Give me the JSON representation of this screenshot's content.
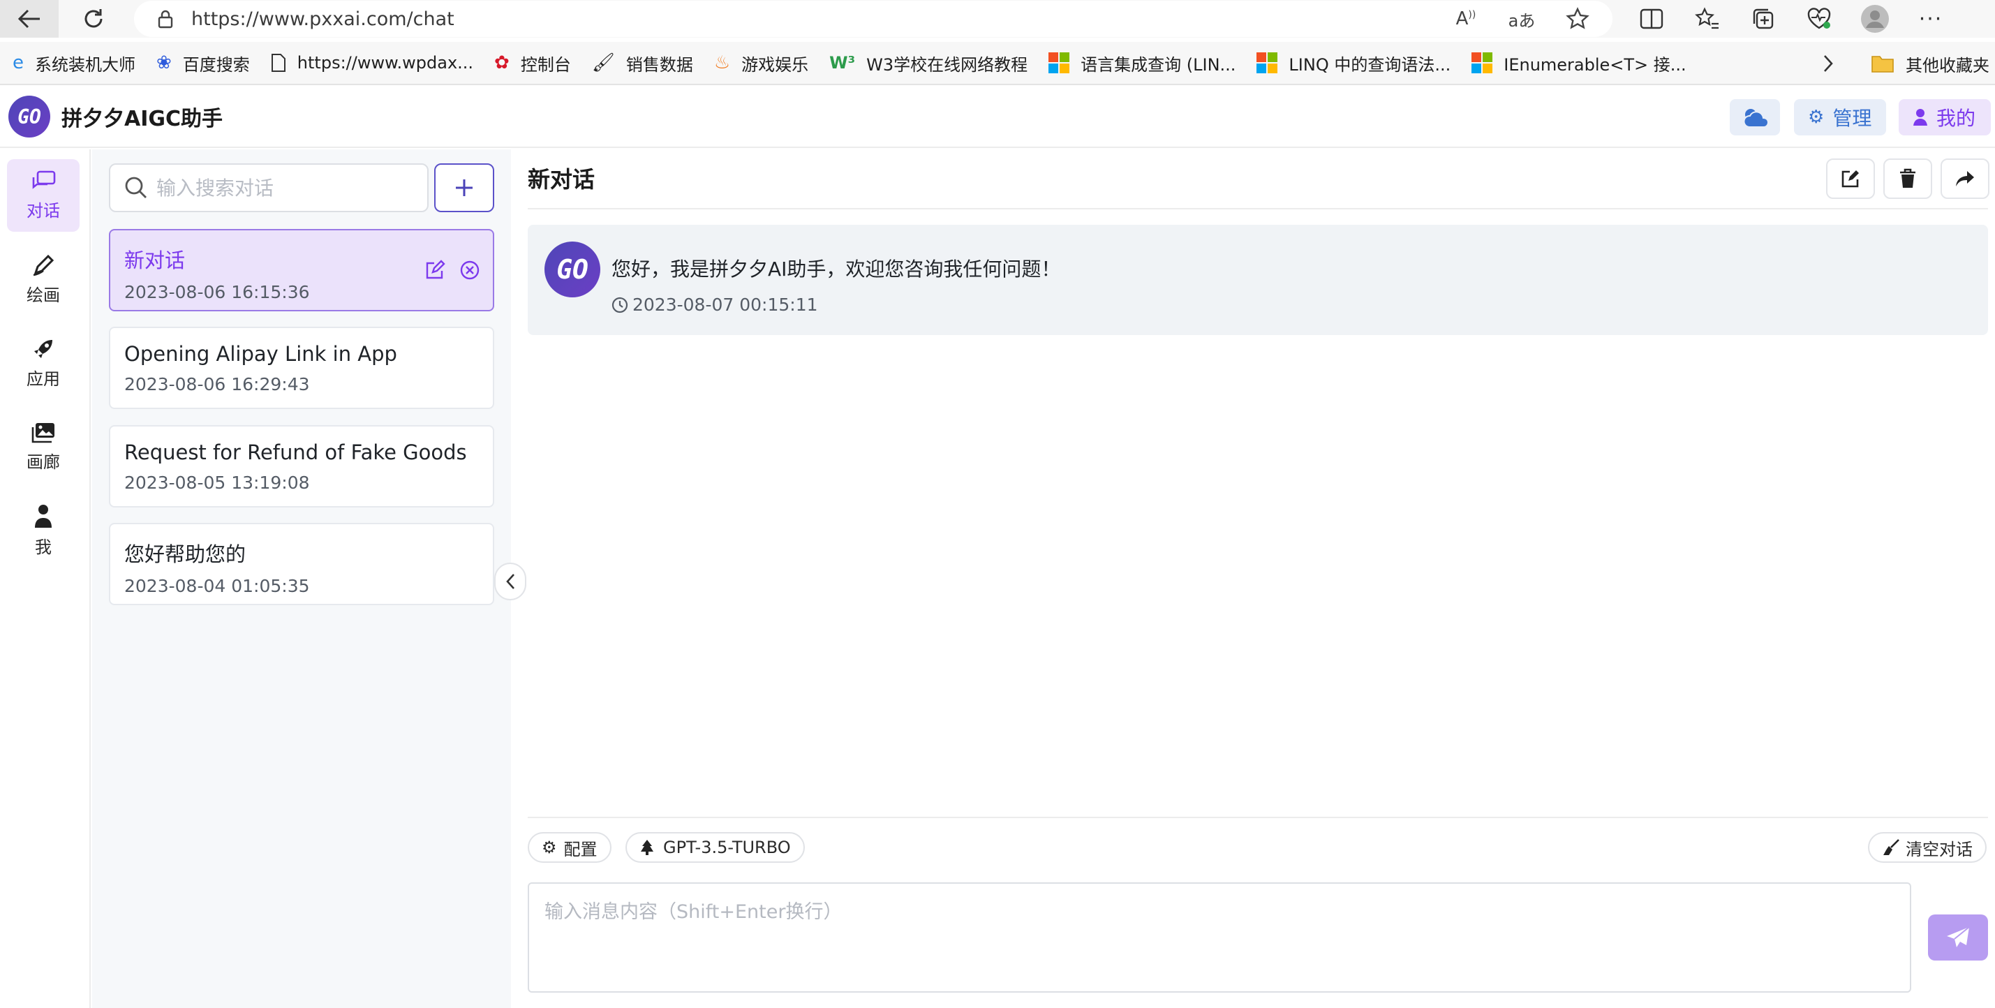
{
  "browser": {
    "url": "https://www.pxxai.com/chat",
    "bookmarks": [
      {
        "label": "系统装机大师",
        "icon": "edge-icon"
      },
      {
        "label": "百度搜索",
        "icon": "baidu-paw-icon"
      },
      {
        "label": "https://www.wpdax...",
        "icon": "page-icon"
      },
      {
        "label": "控制台",
        "icon": "huawei-icon"
      },
      {
        "label": "销售数据",
        "icon": "brush-icon"
      },
      {
        "label": "游戏娱乐",
        "icon": "flame-icon"
      },
      {
        "label": "W3学校在线网络教程",
        "icon": "w3-icon"
      },
      {
        "label": "语言集成查询 (LIN...",
        "icon": "microsoft-icon"
      },
      {
        "label": "LINQ 中的查询语法...",
        "icon": "microsoft-icon"
      },
      {
        "label": "IEnumerable<T> 接...",
        "icon": "microsoft-icon"
      }
    ],
    "other_bookmarks": "其他收藏夹"
  },
  "app": {
    "logo_text": "GO",
    "title": "拼夕夕AIGC助手",
    "admin_label": "管理",
    "mine_label": "我的"
  },
  "rail": [
    {
      "label": "对话",
      "icon": "chat-icon"
    },
    {
      "label": "绘画",
      "icon": "pen-icon"
    },
    {
      "label": "应用",
      "icon": "rocket-icon"
    },
    {
      "label": "画廊",
      "icon": "gallery-icon"
    },
    {
      "label": "我",
      "icon": "user-icon"
    }
  ],
  "search": {
    "placeholder": "输入搜索对话"
  },
  "conversations": [
    {
      "title": "新对话",
      "date": "2023-08-06 16:15:36"
    },
    {
      "title": "Opening Alipay Link in App",
      "date": "2023-08-06 16:29:43"
    },
    {
      "title": "Request for Refund of Fake Goods",
      "date": "2023-08-05 13:19:08"
    },
    {
      "title": "您好帮助您的",
      "date": "2023-08-04 01:05:35"
    }
  ],
  "chat": {
    "title": "新对话",
    "messages": [
      {
        "avatar": "GO",
        "text": "您好，我是拼夕夕AI助手，欢迎您咨询我任何问题！",
        "time": "2023-08-07 00:15:11"
      }
    ],
    "config_label": "配置",
    "model_label": "GPT-3.5-TURBO",
    "clear_label": "清空对话",
    "input_placeholder": "输入消息内容（Shift+Enter换行）"
  },
  "colors": {
    "accent": "#7c3aed",
    "brand": "#4f46b8",
    "admin_blue": "#3a73d0"
  }
}
